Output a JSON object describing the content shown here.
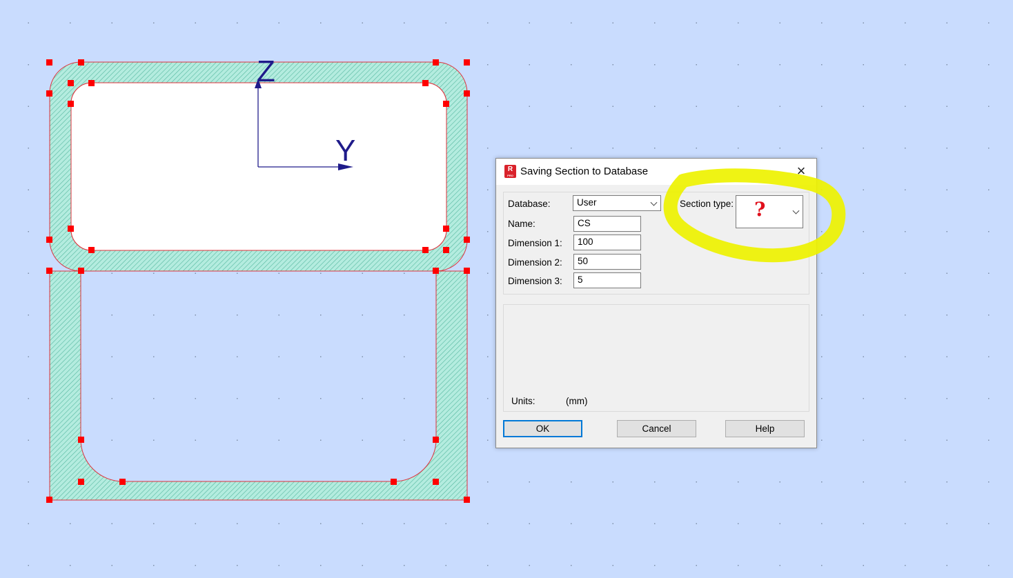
{
  "canvas": {
    "axis_z_label": "Z",
    "axis_y_label": "Y",
    "colors": {
      "background": "#c9dcfe",
      "section_fill": "#a8e6d6",
      "section_edge": "#e0303a",
      "node": "#ff0000",
      "axis": "#1f1b8a",
      "hatch": "#3fa98c"
    }
  },
  "dialog": {
    "title": "Saving Section to Database",
    "app_icon_letter": "R",
    "app_icon_sub": "PRO",
    "close_icon": "×",
    "database_label": "Database:",
    "database_value": "User",
    "name_label": "Name:",
    "name_value": "CS",
    "dim1_label": "Dimension 1:",
    "dim1_value": "100",
    "dim2_label": "Dimension 2:",
    "dim2_value": "50",
    "dim3_label": "Dimension 3:",
    "dim3_value": "5",
    "section_type_label": "Section type:",
    "section_type_value": "?",
    "units_label": "Units:",
    "units_value": "(mm)",
    "ok_label": "OK",
    "cancel_label": "Cancel",
    "help_label": "Help"
  },
  "annotation": {
    "highlight_color": "#f2f200"
  }
}
